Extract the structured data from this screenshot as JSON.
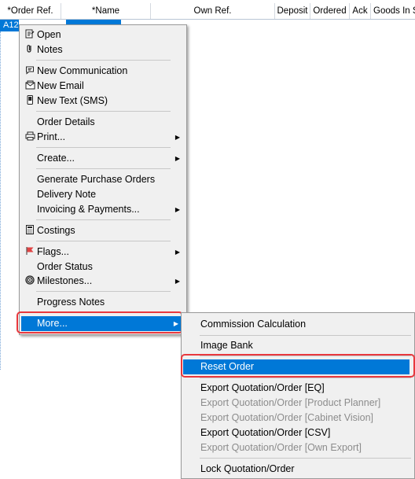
{
  "grid": {
    "columns": [
      "*Order Ref.",
      "*Name",
      "Own Ref.",
      "Deposit",
      "Ordered",
      "Ack",
      "Goods In S"
    ],
    "selected_row_ref": "A12"
  },
  "context_menu": {
    "open": "Open",
    "notes": "Notes",
    "new_communication": "New Communication",
    "new_email": "New Email",
    "new_text": "New Text (SMS)",
    "order_details": "Order Details",
    "print": "Print...",
    "create": "Create...",
    "generate_po": "Generate Purchase Orders",
    "delivery_note": "Delivery Note",
    "invoicing": "Invoicing & Payments...",
    "costings": "Costings",
    "flags": "Flags...",
    "order_status": "Order Status",
    "milestones": "Milestones...",
    "progress_notes": "Progress Notes",
    "more": "More..."
  },
  "submenu": {
    "commission": "Commission Calculation",
    "image_bank": "Image Bank",
    "reset_order": "Reset Order",
    "export_eq": "Export Quotation/Order [EQ]",
    "export_pp": "Export Quotation/Order [Product Planner]",
    "export_cv": "Export Quotation/Order [Cabinet Vision]",
    "export_csv": "Export Quotation/Order [CSV]",
    "export_own": "Export Quotation/Order [Own Export]",
    "lock": "Lock Quotation/Order"
  },
  "icons": {
    "open": "open-icon",
    "notes": "paperclip-icon",
    "communication": "chat-icon",
    "email": "envelope-icon",
    "text": "phone-icon",
    "print": "printer-icon",
    "costings": "calculator-icon",
    "flags": "flag-icon",
    "milestones": "target-icon",
    "submenu_arrow": "chevron-right-icon"
  },
  "colors": {
    "highlight": "#0078d7",
    "annotation": "#e8383d",
    "disabled_text": "#8c8c8c"
  }
}
